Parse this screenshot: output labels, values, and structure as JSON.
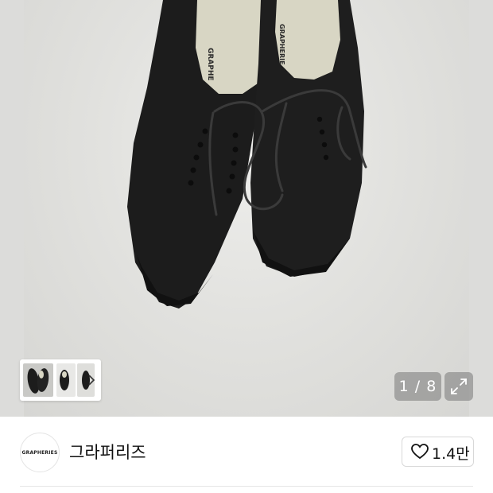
{
  "gallery": {
    "image_alt": "GRAPHERIES black canvas sneakers",
    "insole_print": "GRAPHE",
    "insole_print_2": "GRAPHERIE",
    "counter": "1 / 8",
    "thumbnails": [
      "thumb-1",
      "thumb-2",
      "thumb-3"
    ]
  },
  "brand": {
    "logo_text": "GRAPHERIES",
    "name": "그라퍼리즈",
    "like_count": "1.4만"
  },
  "colors": {
    "shoe": "#1c1c1c",
    "insole": "#d8d6c4",
    "background": "#e4e4e1"
  }
}
